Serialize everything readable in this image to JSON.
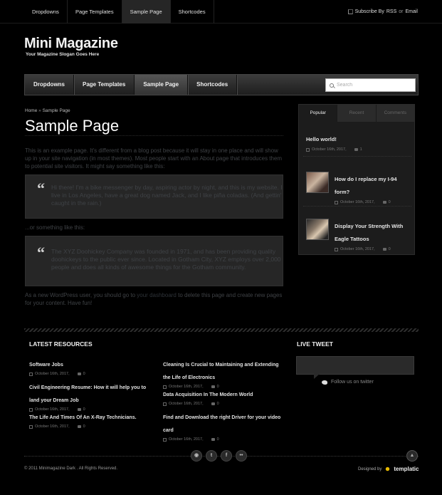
{
  "topbar": {
    "nav": [
      "Dropdowns",
      "Page Templates",
      "Sample Page",
      "Shortcodes"
    ],
    "subscribe_prefix": "Subscribe By",
    "rss": "RSS",
    "or": "or",
    "email": "Email"
  },
  "site": {
    "name": "Mini Magazine",
    "slogan": "Your Magazine Slogan Goes Here"
  },
  "mainnav": {
    "items": [
      "Dropdowns",
      "Page Templates",
      "Sample Page",
      "Shortcodes"
    ],
    "search_placeholder": "Search"
  },
  "breadcrumb": {
    "home": "Home",
    "sep": "»",
    "current": "Sample Page"
  },
  "page": {
    "title": "Sample Page",
    "p1": "This is an example page. It's different from a blog post because it will stay in one place and will show up in your site navigation (in most themes). Most people start with an About page that introduces them to potential site visitors. It might say something like this:",
    "quote1": "Hi there! I'm a bike messenger by day, aspiring actor by night, and this is my website. I live in Los Angeles, have a great dog named Jack, and I like piña coladas. (And gettin' caught in the rain.)",
    "p2": "...or something like this:",
    "quote2": "The XYZ Doohickey Company was founded in 1971, and has been providing quality doohickeys to the public ever since. Located in Gotham City, XYZ employs over 2,000 people and does all kinds of awesome things for the Gotham community.",
    "p3_before": "As a new WordPress user, you should go to ",
    "p3_link": "your dashboard",
    "p3_after": " to delete this page and create new pages for your content. Have fun!"
  },
  "sidebar": {
    "tabs": [
      "Popular",
      "Recent",
      "Comments"
    ],
    "posts": [
      {
        "title": "Hello world!",
        "date": "October 16th, 2017,",
        "comments": "1"
      },
      {
        "title": "How do I replace my I-94 form?",
        "date": "October 16th, 2017,",
        "comments": "0"
      },
      {
        "title": "Display Your Strength With Eagle Tattoos",
        "date": "October 16th, 2017,",
        "comments": "0"
      }
    ]
  },
  "resources": {
    "heading": "LATEST RESOURCES",
    "items": [
      {
        "title": "Software Jobs",
        "date": "October 16th, 2017,",
        "comments": "0"
      },
      {
        "title": "Civil Engineering Resume: How it will help you to land your Dream Job",
        "date": "October 16th, 2017,",
        "comments": "0"
      },
      {
        "title": "The Life And Times Of An X-Ray Technicians.",
        "date": "October 16th, 2017,",
        "comments": "0"
      },
      {
        "title": "Cleaning Is Crucial to Maintaining and Extending the Life of Electronics",
        "date": "October 16th, 2017,",
        "comments": "0"
      },
      {
        "title": "Data Acquisition In The Modern World",
        "date": "October 16th, 2017,",
        "comments": "0"
      },
      {
        "title": "Find and Download the right Driver for your video card",
        "date": "October 16th, 2017,",
        "comments": "0"
      }
    ]
  },
  "tweet": {
    "heading": "LIVE TWEET",
    "follow": "Follow us on twitter"
  },
  "footer": {
    "copyright": "© 2011 Minimagazine Dark . All Rights Reserved.",
    "designed_by": "Designed by",
    "brand": "templatic",
    "social_icons": [
      "rss-icon",
      "twitter-icon",
      "facebook-icon",
      "flickr-icon"
    ]
  }
}
